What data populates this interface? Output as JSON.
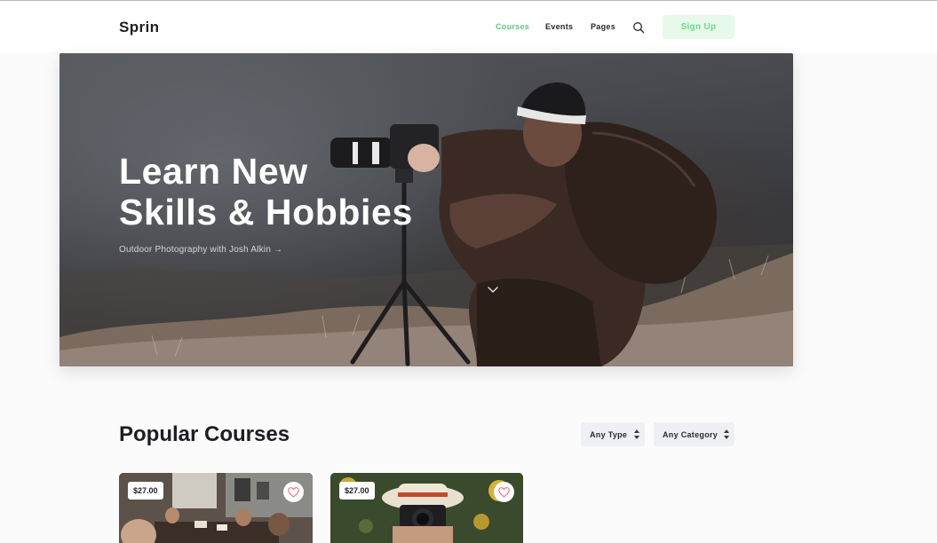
{
  "header": {
    "logo": "Sprin",
    "nav": [
      {
        "label": "Courses",
        "active": true
      },
      {
        "label": "Events",
        "active": false
      },
      {
        "label": "Pages",
        "active": false
      }
    ],
    "search_icon": "search-icon",
    "signup_label": "Sign Up"
  },
  "hero": {
    "title_line1": "Learn New",
    "title_line2": "Skills & Hobbies",
    "subtitle": "Outdoor Photography with Josh Alkin →",
    "scroll_icon": "chevron-down-icon"
  },
  "courses": {
    "title": "Popular Courses",
    "filters": {
      "type": "Any Type",
      "category": "Any Category"
    },
    "cards": [
      {
        "price": "$27.00",
        "favorite_icon": "heart-icon"
      },
      {
        "price": "$27.00",
        "favorite_icon": "heart-icon"
      }
    ]
  },
  "colors": {
    "accent": "#5cc97f",
    "signup_bg": "#e6f9ea",
    "filter_bg": "#eef0f4",
    "heart": "#f06a86"
  }
}
